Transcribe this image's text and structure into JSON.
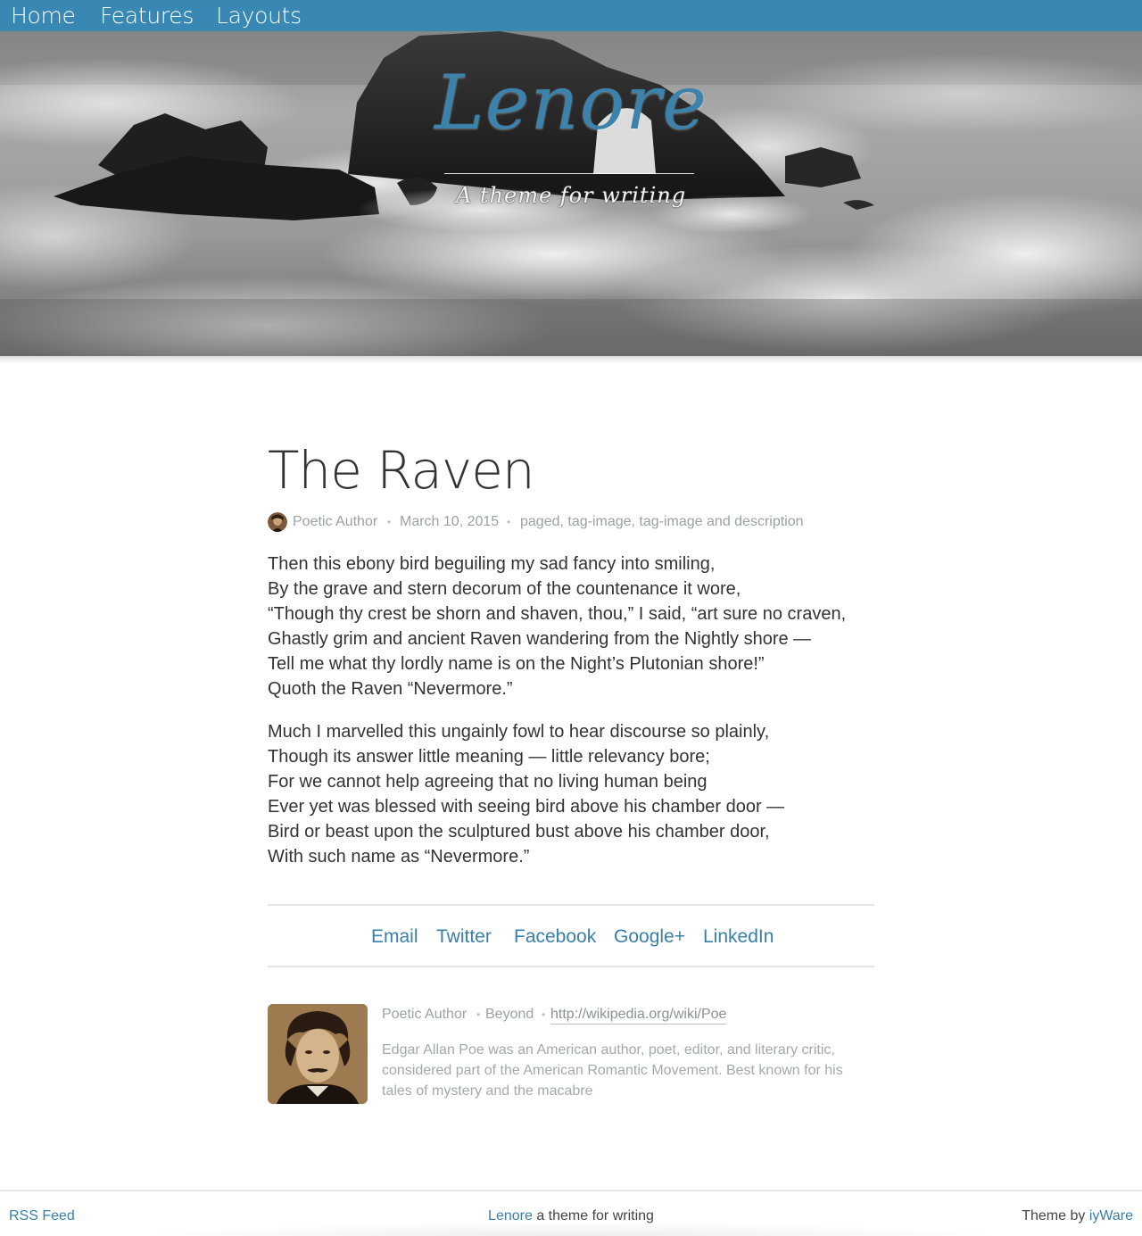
{
  "nav": {
    "items": [
      {
        "label": "Home"
      },
      {
        "label": "Features"
      },
      {
        "label": "Layouts"
      }
    ]
  },
  "hero": {
    "title": "Lenore",
    "subtitle": "A theme for writing"
  },
  "post": {
    "title": "The Raven",
    "author": "Poetic Author",
    "separator": "•",
    "date": "March 10, 2015",
    "tags": "paged, tag-image, tag-image and description",
    "stanzas": [
      [
        "Then this ebony bird beguiling my sad fancy into smiling,",
        "By the grave and stern decorum of the countenance it wore,",
        "“Though thy crest be shorn and shaven, thou,” I said, “art sure no craven,",
        "Ghastly grim and ancient Raven wandering from the Nightly shore —",
        "Tell me what thy lordly name is on the Night’s Plutonian shore!”",
        "Quoth the Raven “Nevermore.”"
      ],
      [
        "Much I marvelled this ungainly fowl to hear discourse so plainly,",
        "Though its answer little meaning — little relevancy bore;",
        "For we cannot help agreeing that no living human being",
        "Ever yet was blessed with seeing bird above his chamber door —",
        "Bird or beast upon the sculptured bust above his chamber door,",
        "With such name as “Nevermore.”"
      ]
    ]
  },
  "share": {
    "email": "Email",
    "twitter": "Twitter",
    "facebook": "Facebook",
    "google": "Google+",
    "linkedin": "LinkedIn"
  },
  "bio": {
    "name": "Poetic Author",
    "separator": "•",
    "location": "Beyond",
    "website": "http://wikipedia.org/wiki/Poe",
    "text": "Edgar Allan Poe was an American author, poet, editor, and literary critic, considered part of the American Romantic Movement. Best known for his tales of mystery and the macabre"
  },
  "footer": {
    "rss": "RSS Feed",
    "brand": "Lenore",
    "tagline": " a theme for writing",
    "theme_by": "Theme by ",
    "theme_author": "iyWare"
  },
  "colors": {
    "nav_bg": "#3888b3",
    "accent": "#3a7fa8",
    "brand": "#3c82aa"
  }
}
